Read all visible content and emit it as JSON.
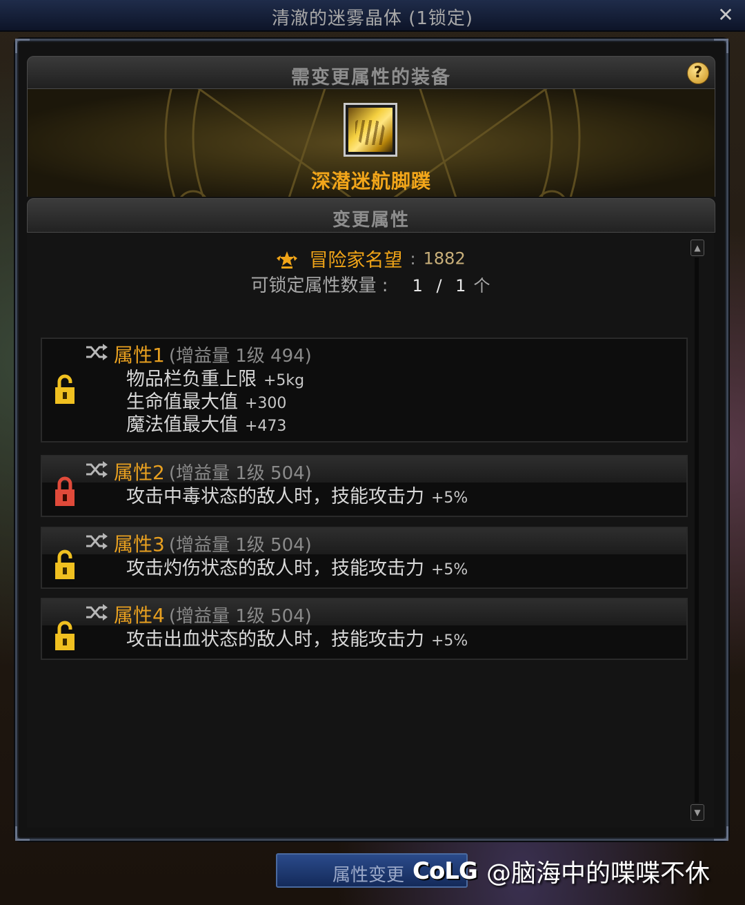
{
  "window": {
    "title": "清澈的迷雾晶体 (1锁定)",
    "close_icon": "close-icon"
  },
  "equipment_section": {
    "header": "需变更属性的装备",
    "help_label": "?",
    "item_name": "深潜迷航脚蹼",
    "item_name_color": "#f2a61a"
  },
  "change_section": {
    "header": "变更属性",
    "fame_label": "冒险家名望",
    "fame_colon": ":",
    "fame_value": "1882",
    "lock_label": "可锁定属性数量 :",
    "lock_count": "1 / 1",
    "lock_unit": "个"
  },
  "attributes": [
    {
      "title": "属性1",
      "detail": "(增益量 1级 494)",
      "locked": false,
      "lines": [
        {
          "text": "物品栏负重上限",
          "value": "+5kg"
        },
        {
          "text": "生命值最大值",
          "value": "+300"
        },
        {
          "text": "魔法值最大值",
          "value": "+473"
        }
      ]
    },
    {
      "title": "属性2",
      "detail": "(增益量 1级 504)",
      "locked": true,
      "lines": [
        {
          "text": "攻击中毒状态的敌人时，技能攻击力",
          "value": "+5%"
        }
      ]
    },
    {
      "title": "属性3",
      "detail": "(增益量 1级 504)",
      "locked": false,
      "lines": [
        {
          "text": "攻击灼伤状态的敌人时，技能攻击力",
          "value": "+5%"
        }
      ]
    },
    {
      "title": "属性4",
      "detail": "(增益量 1级 504)",
      "locked": false,
      "lines": [
        {
          "text": "攻击出血状态的敌人时，技能攻击力",
          "value": "+5%"
        }
      ]
    }
  ],
  "bottom": {
    "change_button": "属性变更",
    "watermark_logo": "CoLG",
    "watermark_user": "@脑海中的喋喋不休"
  },
  "colors": {
    "accent_gold": "#e8a020",
    "lock_open": "#f0c020",
    "lock_closed": "#e04a3a",
    "button_blue": "#1e3a72"
  }
}
